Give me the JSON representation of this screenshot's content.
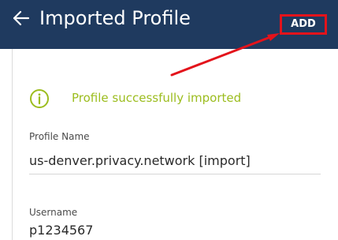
{
  "header": {
    "title": "Imported Profile",
    "add_label": "ADD"
  },
  "status": {
    "message": "Profile successfully imported"
  },
  "form": {
    "profile_name_label": "Profile Name",
    "profile_name_value": "us-denver.privacy.network [import]",
    "username_label": "Username",
    "username_value": "p1234567"
  },
  "icons": {
    "back": "back-arrow-icon",
    "info": "info-icon"
  },
  "colors": {
    "header_bg": "#1f3a5f",
    "success": "#9cbd1f",
    "annotation": "#e3131b"
  }
}
